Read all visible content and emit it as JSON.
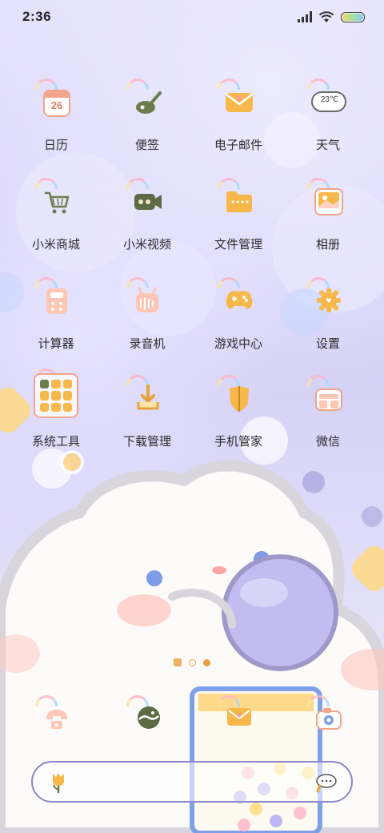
{
  "status_bar": {
    "time": "2:36"
  },
  "apps": [
    {
      "label": "日历",
      "icon": "calendar-icon",
      "icon_text": "26"
    },
    {
      "label": "便签",
      "icon": "notes-icon"
    },
    {
      "label": "电子邮件",
      "icon": "email-icon"
    },
    {
      "label": "天气",
      "icon": "weather-icon",
      "icon_text": "23℃"
    },
    {
      "label": "小米商城",
      "icon": "shopping-cart-icon"
    },
    {
      "label": "小米视频",
      "icon": "video-camera-icon"
    },
    {
      "label": "文件管理",
      "icon": "folder-icon"
    },
    {
      "label": "相册",
      "icon": "photo-icon"
    },
    {
      "label": "计算器",
      "icon": "calculator-icon"
    },
    {
      "label": "录音机",
      "icon": "recorder-icon"
    },
    {
      "label": "游戏中心",
      "icon": "gamepad-icon"
    },
    {
      "label": "设置",
      "icon": "gear-icon"
    },
    {
      "label": "系统工具",
      "icon": "folder-grid-icon"
    },
    {
      "label": "下载管理",
      "icon": "download-icon"
    },
    {
      "label": "手机管家",
      "icon": "shield-icon"
    },
    {
      "label": "微信",
      "icon": "wechat-icon"
    }
  ],
  "dock": [
    {
      "icon": "phone-icon"
    },
    {
      "icon": "browser-icon"
    },
    {
      "icon": "messages-icon"
    },
    {
      "icon": "camera-icon"
    }
  ],
  "colors": {
    "accent_orange": "#e8a23c",
    "search_border": "#8b86c8",
    "label_text": "#2c2c2c"
  }
}
